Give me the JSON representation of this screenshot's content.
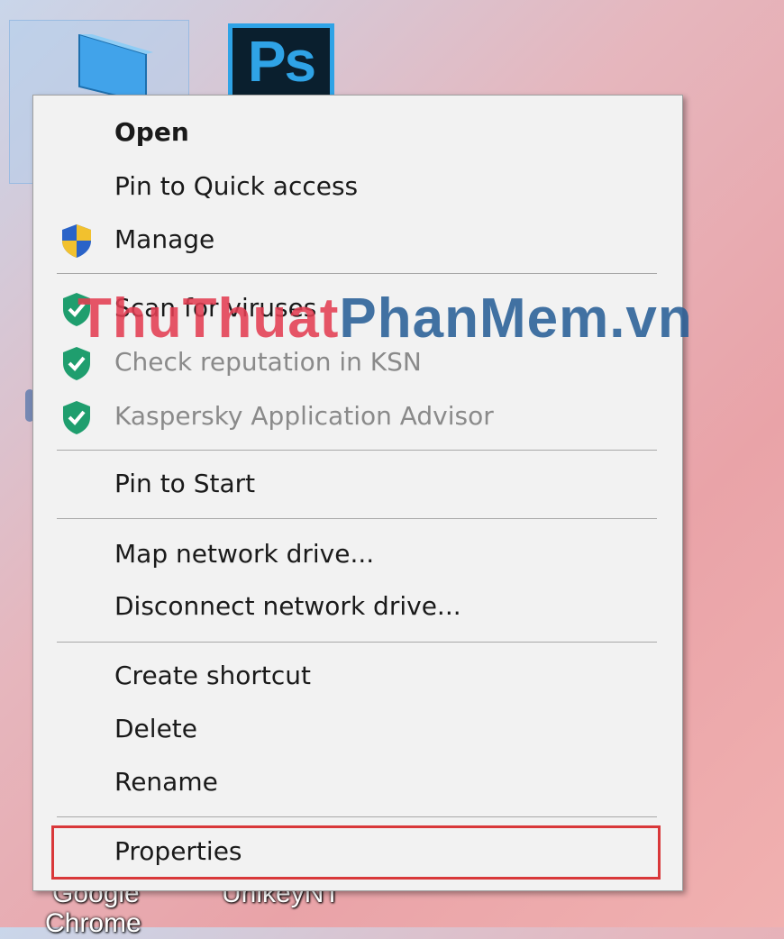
{
  "desktop": {
    "ps_icon_text": "Ps",
    "label_google": "Google",
    "label_chrome": "Chrome",
    "label_unikey": "UnikeyNT"
  },
  "context_menu": {
    "items": [
      {
        "label": "Open",
        "icon": null,
        "bold": true,
        "disabled": false
      },
      {
        "label": "Pin to Quick access",
        "icon": null,
        "bold": false,
        "disabled": false
      },
      {
        "label": "Manage",
        "icon": "uac-shield-icon",
        "bold": false,
        "disabled": false
      },
      {
        "label": "Scan for viruses",
        "icon": "kaspersky-shield-icon",
        "bold": false,
        "disabled": false
      },
      {
        "label": "Check reputation in KSN",
        "icon": "kaspersky-shield-icon",
        "bold": false,
        "disabled": true
      },
      {
        "label": "Kaspersky Application Advisor",
        "icon": "kaspersky-shield-icon",
        "bold": false,
        "disabled": true
      },
      {
        "label": "Pin to Start",
        "icon": null,
        "bold": false,
        "disabled": false
      },
      {
        "label": "Map network drive...",
        "icon": null,
        "bold": false,
        "disabled": false
      },
      {
        "label": "Disconnect network drive...",
        "icon": null,
        "bold": false,
        "disabled": false
      },
      {
        "label": "Create shortcut",
        "icon": null,
        "bold": false,
        "disabled": false
      },
      {
        "label": "Delete",
        "icon": null,
        "bold": false,
        "disabled": false
      },
      {
        "label": "Rename",
        "icon": null,
        "bold": false,
        "disabled": false
      },
      {
        "label": "Properties",
        "icon": null,
        "bold": false,
        "disabled": false,
        "highlighted": true
      }
    ]
  },
  "watermark": {
    "part1": "ThuThuat",
    "part2": "PhanMem.vn"
  },
  "colors": {
    "highlight_border": "#d9383a",
    "kaspersky_green": "#1f9e6e",
    "uac_blue": "#2a63c8",
    "uac_yellow": "#f2c12e"
  }
}
